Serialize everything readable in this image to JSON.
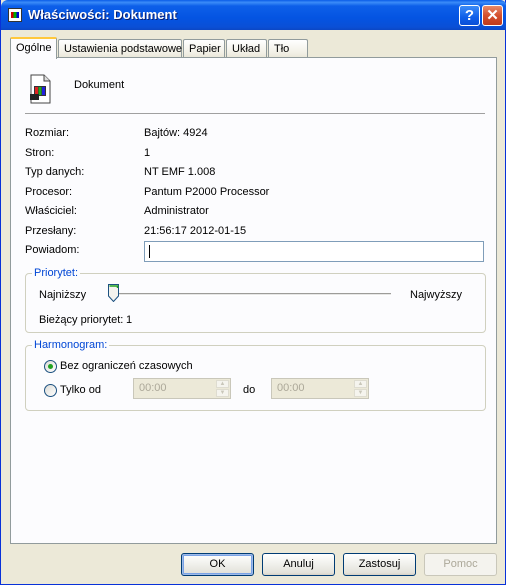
{
  "window": {
    "title": "Właściwości: Dokument",
    "controls": {
      "help": "?",
      "close": "✕"
    }
  },
  "tabs": [
    {
      "label": "Ogólne",
      "active": true
    },
    {
      "label": "Ustawienia podstawowe",
      "active": false
    },
    {
      "label": "Papier",
      "active": false
    },
    {
      "label": "Układ",
      "active": false
    },
    {
      "label": "Tło",
      "active": false
    }
  ],
  "general": {
    "doc_icon": "document-printer-icon",
    "doc_name": "Dokument",
    "fields": [
      {
        "label": "Rozmiar:",
        "value": "Bajtów: 4924"
      },
      {
        "label": "Stron:",
        "value": "1"
      },
      {
        "label": "Typ danych:",
        "value": "NT EMF 1.008"
      },
      {
        "label": "Procesor:",
        "value": "Pantum P2000 Processor"
      },
      {
        "label": "Właściciel:",
        "value": "Administrator"
      },
      {
        "label": "Przesłany:",
        "value": "21:56:17  2012-01-15"
      }
    ],
    "notify": {
      "label": "Powiadom:",
      "value": ""
    }
  },
  "priority": {
    "legend": "Priorytet:",
    "low_label": "Najniższy",
    "high_label": "Najwyższy",
    "current_label": "Bieżący priorytet:",
    "current_value": "1",
    "slider_value": 1,
    "slider_min": 1,
    "slider_max": 99
  },
  "schedule": {
    "legend": "Harmonogram:",
    "no_limit_label": "Bez ograniczeń czasowych",
    "no_limit_checked": true,
    "only_from_label": "Tylko od",
    "only_from_checked": false,
    "from_time": "00:00",
    "to_label": "do",
    "to_time": "00:00"
  },
  "buttons": {
    "ok": "OK",
    "cancel": "Anuluj",
    "apply": "Zastosuj",
    "help": "Pomoc"
  },
  "colors": {
    "title_bar": "#0454e2",
    "group_legend": "#0046d5",
    "radio_dot": "#21a121",
    "tab_highlight": "#ffc83c"
  }
}
